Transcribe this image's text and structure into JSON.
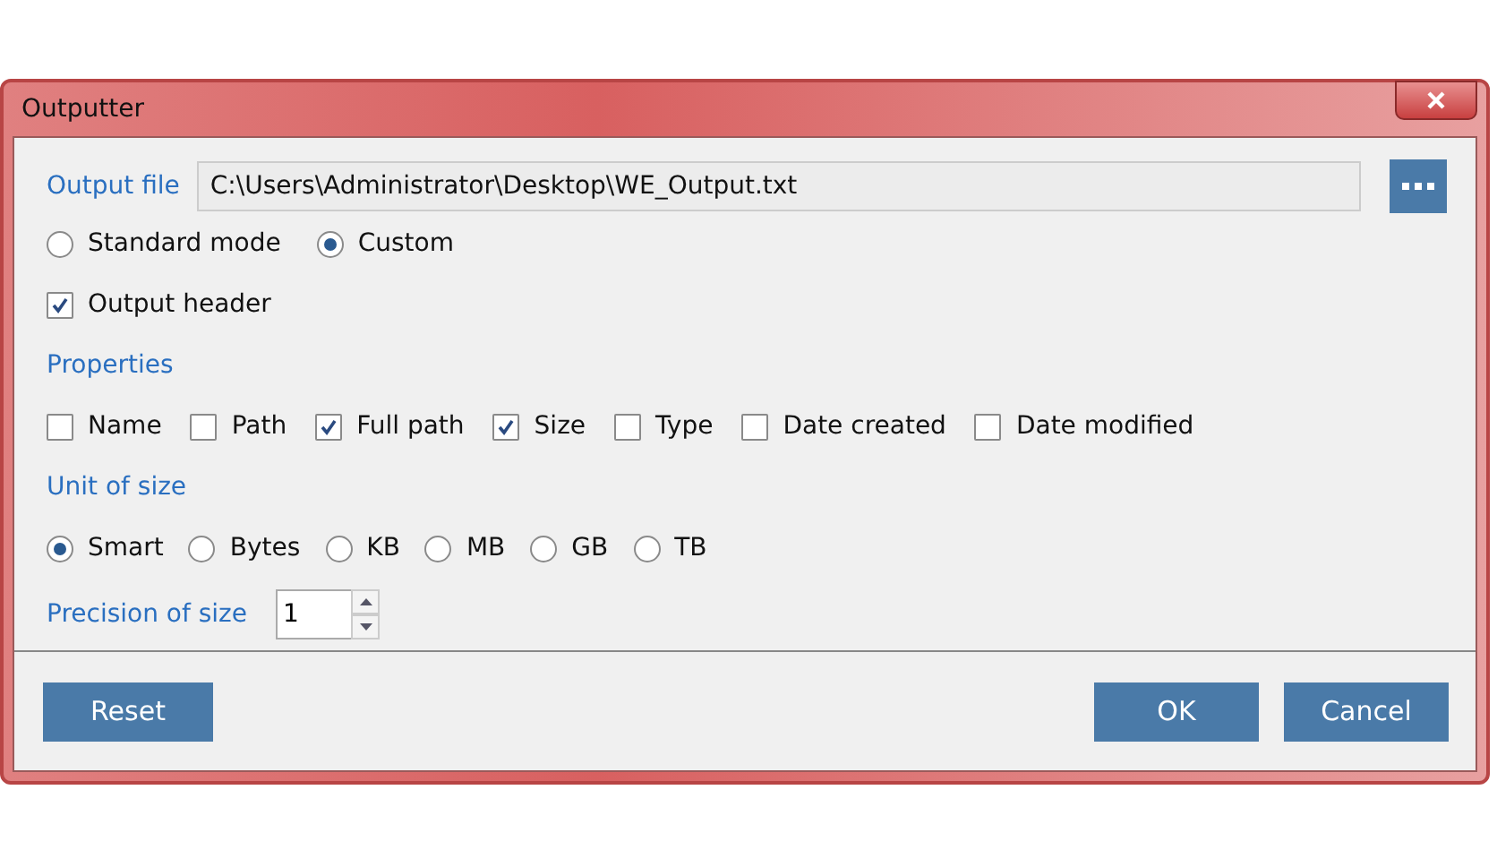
{
  "window": {
    "title": "Outputter"
  },
  "output_file": {
    "label": "Output file",
    "value": "C:\\Users\\Administrator\\Desktop\\WE_Output.txt"
  },
  "modes": [
    {
      "label": "Standard mode",
      "selected": false
    },
    {
      "label": "Custom",
      "selected": true
    }
  ],
  "output_header": {
    "label": "Output header",
    "checked": true
  },
  "properties": {
    "title": "Properties",
    "items": [
      {
        "label": "Name",
        "checked": false
      },
      {
        "label": "Path",
        "checked": false
      },
      {
        "label": "Full path",
        "checked": true
      },
      {
        "label": "Size",
        "checked": true
      },
      {
        "label": "Type",
        "checked": false
      },
      {
        "label": "Date created",
        "checked": false
      },
      {
        "label": "Date modified",
        "checked": false
      }
    ]
  },
  "unit_of_size": {
    "title": "Unit of size",
    "options": [
      {
        "label": "Smart",
        "selected": true
      },
      {
        "label": "Bytes",
        "selected": false
      },
      {
        "label": "KB",
        "selected": false
      },
      {
        "label": "MB",
        "selected": false
      },
      {
        "label": "GB",
        "selected": false
      },
      {
        "label": "TB",
        "selected": false
      }
    ]
  },
  "precision": {
    "label": "Precision of size",
    "value": "1"
  },
  "buttons": {
    "left": [
      "Reset"
    ],
    "right": [
      "OK",
      "Cancel"
    ]
  }
}
